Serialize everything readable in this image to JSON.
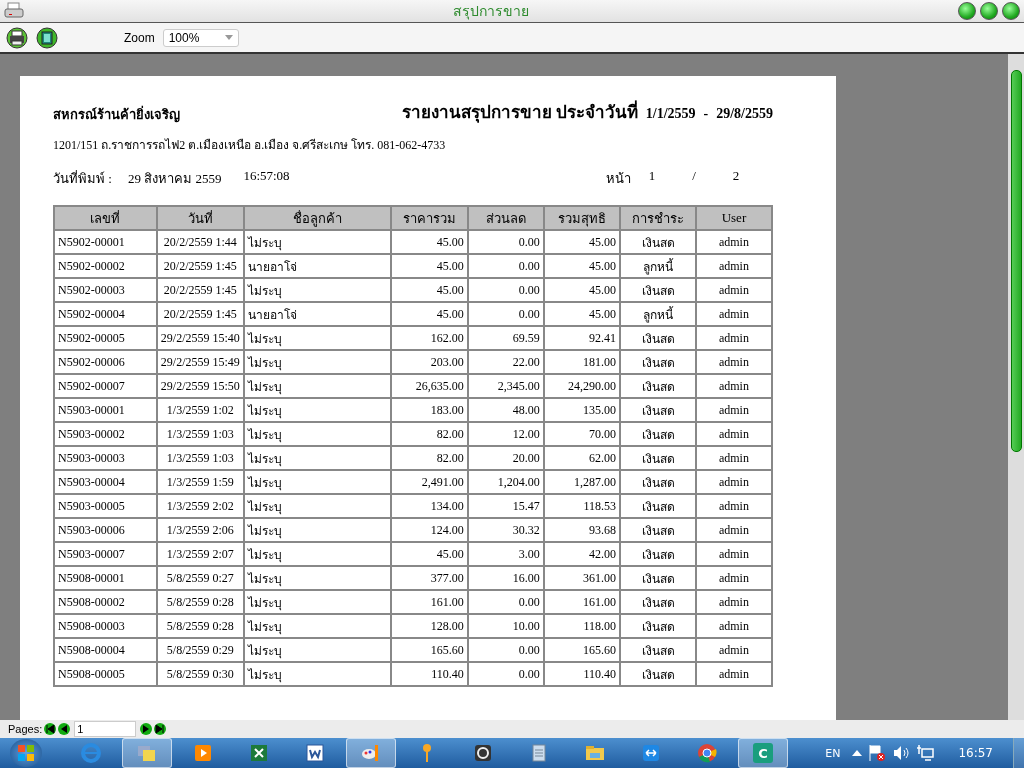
{
  "window": {
    "title": "สรุปการขาย"
  },
  "toolbar": {
    "zoom_label": "Zoom",
    "zoom_value": "100%"
  },
  "report": {
    "company": "สหกรณ์ร้านค้ายิ่งเจริญ",
    "title": "รายงานสรุปการขาย  ประจำวันที่",
    "date_from": "1/1/2559",
    "date_sep": "-",
    "date_to": "29/8/2559",
    "address": "1201/151 ถ.ราชการรถไฟ2 ต.เมืองเหนือ อ.เมือง จ.ศรีสะเกษ  โทร. 081-062-4733",
    "print_label": "วันที่พิมพ์ :",
    "print_date": "29 สิงหาคม 2559",
    "print_time": "16:57:08",
    "page_label": "หน้า",
    "page": "1",
    "page_sep": "/",
    "page_total": "2"
  },
  "table": {
    "columns": [
      "เลขที่",
      "วันที่",
      "ชื่อลูกค้า",
      "ราคารวม",
      "ส่วนลด",
      "รวมสุทธิ",
      "การชำระ",
      "User"
    ],
    "rows": [
      [
        "N5902-00001",
        "20/2/2559 1:44",
        "ไม่ระบุ",
        "45.00",
        "0.00",
        "45.00",
        "เงินสด",
        "admin"
      ],
      [
        "N5902-00002",
        "20/2/2559 1:45",
        "นายอาโจ่",
        "45.00",
        "0.00",
        "45.00",
        "ลูกหนี้",
        "admin"
      ],
      [
        "N5902-00003",
        "20/2/2559 1:45",
        "ไม่ระบุ",
        "45.00",
        "0.00",
        "45.00",
        "เงินสด",
        "admin"
      ],
      [
        "N5902-00004",
        "20/2/2559 1:45",
        "นายอาโจ่",
        "45.00",
        "0.00",
        "45.00",
        "ลูกหนี้",
        "admin"
      ],
      [
        "N5902-00005",
        "29/2/2559 15:40",
        "ไม่ระบุ",
        "162.00",
        "69.59",
        "92.41",
        "เงินสด",
        "admin"
      ],
      [
        "N5902-00006",
        "29/2/2559 15:49",
        "ไม่ระบุ",
        "203.00",
        "22.00",
        "181.00",
        "เงินสด",
        "admin"
      ],
      [
        "N5902-00007",
        "29/2/2559 15:50",
        "ไม่ระบุ",
        "26,635.00",
        "2,345.00",
        "24,290.00",
        "เงินสด",
        "admin"
      ],
      [
        "N5903-00001",
        "1/3/2559 1:02",
        "ไม่ระบุ",
        "183.00",
        "48.00",
        "135.00",
        "เงินสด",
        "admin"
      ],
      [
        "N5903-00002",
        "1/3/2559 1:03",
        "ไม่ระบุ",
        "82.00",
        "12.00",
        "70.00",
        "เงินสด",
        "admin"
      ],
      [
        "N5903-00003",
        "1/3/2559 1:03",
        "ไม่ระบุ",
        "82.00",
        "20.00",
        "62.00",
        "เงินสด",
        "admin"
      ],
      [
        "N5903-00004",
        "1/3/2559 1:59",
        "ไม่ระบุ",
        "2,491.00",
        "1,204.00",
        "1,287.00",
        "เงินสด",
        "admin"
      ],
      [
        "N5903-00005",
        "1/3/2559 2:02",
        "ไม่ระบุ",
        "134.00",
        "15.47",
        "118.53",
        "เงินสด",
        "admin"
      ],
      [
        "N5903-00006",
        "1/3/2559 2:06",
        "ไม่ระบุ",
        "124.00",
        "30.32",
        "93.68",
        "เงินสด",
        "admin"
      ],
      [
        "N5903-00007",
        "1/3/2559 2:07",
        "ไม่ระบุ",
        "45.00",
        "3.00",
        "42.00",
        "เงินสด",
        "admin"
      ],
      [
        "N5908-00001",
        "5/8/2559 0:27",
        "ไม่ระบุ",
        "377.00",
        "16.00",
        "361.00",
        "เงินสด",
        "admin"
      ],
      [
        "N5908-00002",
        "5/8/2559 0:28",
        "ไม่ระบุ",
        "161.00",
        "0.00",
        "161.00",
        "เงินสด",
        "admin"
      ],
      [
        "N5908-00003",
        "5/8/2559 0:28",
        "ไม่ระบุ",
        "128.00",
        "10.00",
        "118.00",
        "เงินสด",
        "admin"
      ],
      [
        "N5908-00004",
        "5/8/2559 0:29",
        "ไม่ระบุ",
        "165.60",
        "0.00",
        "165.60",
        "เงินสด",
        "admin"
      ],
      [
        "N5908-00005",
        "5/8/2559 0:30",
        "ไม่ระบุ",
        "110.40",
        "0.00",
        "110.40",
        "เงินสด",
        "admin"
      ]
    ]
  },
  "pager": {
    "label": "Pages:",
    "value": "1"
  },
  "taskbar": {
    "apps": [
      {
        "kind": "ie",
        "selected": false
      },
      {
        "kind": "folders",
        "selected": true
      },
      {
        "kind": "media",
        "selected": false
      },
      {
        "kind": "excel",
        "selected": false
      },
      {
        "kind": "word",
        "selected": false
      },
      {
        "kind": "paint",
        "selected": true
      },
      {
        "kind": "key",
        "selected": false
      },
      {
        "kind": "camera",
        "selected": false
      },
      {
        "kind": "notepad",
        "selected": false
      },
      {
        "kind": "explorer",
        "selected": false
      },
      {
        "kind": "remote",
        "selected": false
      },
      {
        "kind": "chrome",
        "selected": false
      },
      {
        "kind": "app",
        "selected": true,
        "letter": "C"
      }
    ],
    "language": "EN",
    "clock": "16:57"
  }
}
